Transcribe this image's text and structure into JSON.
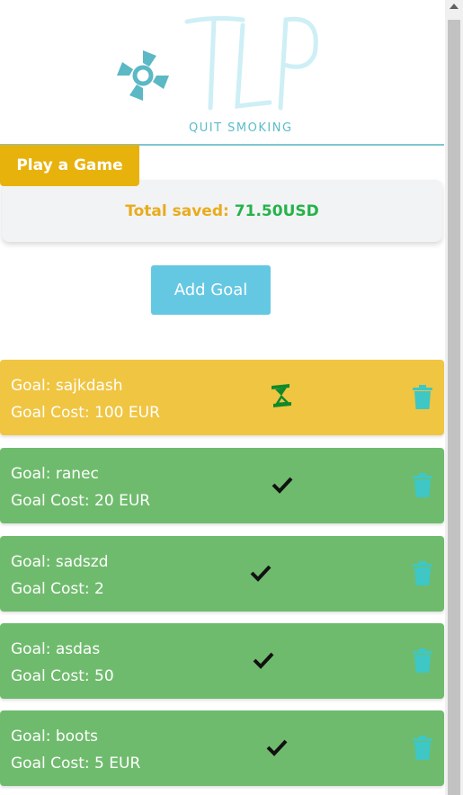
{
  "header": {
    "logo_text": "TLP",
    "tagline": "QUIT SMOKING"
  },
  "play_button": {
    "label": "Play a Game"
  },
  "savings": {
    "label": "Total saved:",
    "value": "71.50USD"
  },
  "add_goal_button": {
    "label": "Add Goal"
  },
  "goals": [
    {
      "name": "Goal: sajkdash",
      "cost": "Goal Cost: 100 EUR",
      "status": "pending",
      "status_icon": "hourglass-icon"
    },
    {
      "name": "Goal: ranec",
      "cost": "Goal Cost: 20 EUR",
      "status": "done",
      "status_icon": "checkmark-icon"
    },
    {
      "name": "Goal: sadszd",
      "cost": "Goal Cost: 2",
      "status": "done",
      "status_icon": "checkmark-icon"
    },
    {
      "name": "Goal: asdas",
      "cost": "Goal Cost: 50",
      "status": "done",
      "status_icon": "checkmark-icon"
    },
    {
      "name": "Goal: boots",
      "cost": "Goal Cost: 5 EUR",
      "status": "done",
      "status_icon": "checkmark-icon"
    }
  ],
  "colors": {
    "accent_yellow": "#e8b20d",
    "pending_goal": "#f0c542",
    "done_goal": "#6fbb6d",
    "add_button": "#65c8e3",
    "trash_icon": "#3ec7c4",
    "saved_value": "#25b34a"
  }
}
